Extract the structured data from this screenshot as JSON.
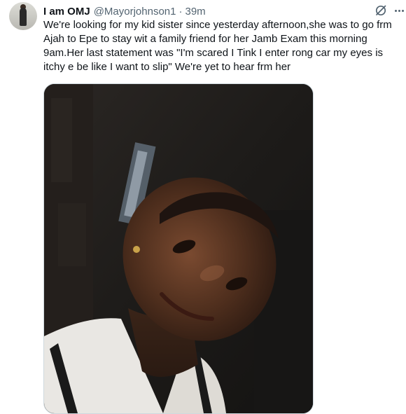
{
  "author": {
    "display_name": "I am OMJ",
    "handle": "@Mayorjohnson1",
    "separator": "·",
    "timestamp": "39m"
  },
  "icons": {
    "grok": "grok-icon",
    "more": "more-options-icon"
  },
  "tweet": {
    "lines": [
      "We're looking for my kid sister since yesterday afternoon,she was to go frm",
      "Ajah to Epe to stay wit a family friend for her Jamb Exam this morning",
      "9am.Her last statement was \"I'm scared I Tink I enter rong car my eyes is",
      "itchy e be like I want to slip\" We're yet to hear frm her"
    ]
  },
  "colors": {
    "text": "#0f1419",
    "secondary": "#536471",
    "border": "#cfd9de"
  }
}
